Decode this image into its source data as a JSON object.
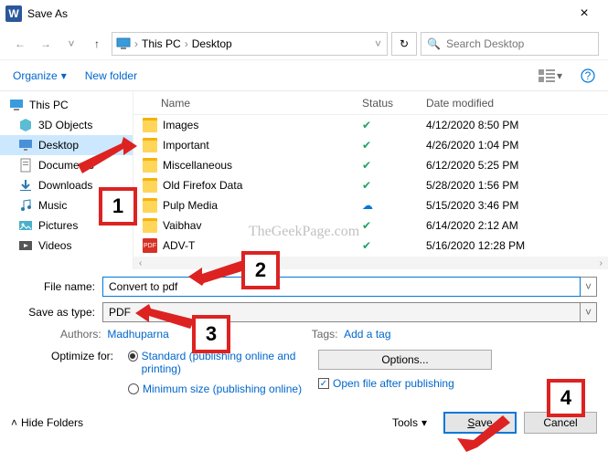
{
  "title": "Save As",
  "breadcrumb": {
    "root": "This PC",
    "folder": "Desktop"
  },
  "search_placeholder": "Search Desktop",
  "toolbar": {
    "organize": "Organize",
    "new_folder": "New folder"
  },
  "sidebar": {
    "root": "This PC",
    "items": [
      {
        "label": "3D Objects",
        "icon": "cube"
      },
      {
        "label": "Desktop",
        "icon": "desktop",
        "selected": true
      },
      {
        "label": "Documents",
        "icon": "doc"
      },
      {
        "label": "Downloads",
        "icon": "down"
      },
      {
        "label": "Music",
        "icon": "music"
      },
      {
        "label": "Pictures",
        "icon": "pic"
      },
      {
        "label": "Videos",
        "icon": "vid"
      }
    ]
  },
  "columns": {
    "name": "Name",
    "status": "Status",
    "date": "Date modified"
  },
  "files": [
    {
      "name": "Images",
      "type": "folder",
      "status": "check",
      "date": "4/12/2020 8:50 PM"
    },
    {
      "name": "Important",
      "type": "folder",
      "status": "check",
      "date": "4/26/2020 1:04 PM"
    },
    {
      "name": "Miscellaneous",
      "type": "folder",
      "status": "check",
      "date": "6/12/2020 5:25 PM"
    },
    {
      "name": "Old Firefox Data",
      "type": "folder",
      "status": "check",
      "date": "5/28/2020 1:56 PM"
    },
    {
      "name": "Pulp Media",
      "type": "folder",
      "status": "cloud",
      "date": "5/15/2020 3:46 PM"
    },
    {
      "name": "Vaibhav",
      "type": "folder",
      "status": "check",
      "date": "6/14/2020 2:12 AM"
    },
    {
      "name": "ADV-T",
      "type": "pdf",
      "status": "check",
      "date": "5/16/2020 12:28 PM"
    }
  ],
  "form": {
    "file_name_label": "File name:",
    "file_name_value": "Convert to pdf",
    "save_type_label": "Save as type:",
    "save_type_value": "PDF",
    "authors_label": "Authors:",
    "authors_value": "Madhuparna",
    "tags_label": "Tags:",
    "tags_value": "Add a tag",
    "optimize_label": "Optimize for:",
    "radio_standard": "Standard (publishing online and printing)",
    "radio_min": "Minimum size (publishing online)",
    "options_btn": "Options...",
    "open_after": "Open file after publishing"
  },
  "footer": {
    "hide": "Hide Folders",
    "tools": "Tools",
    "save": "Save",
    "cancel": "Cancel"
  },
  "annotations": {
    "n1": "1",
    "n2": "2",
    "n3": "3",
    "n4": "4"
  },
  "watermark": "TheGeekPage.com"
}
